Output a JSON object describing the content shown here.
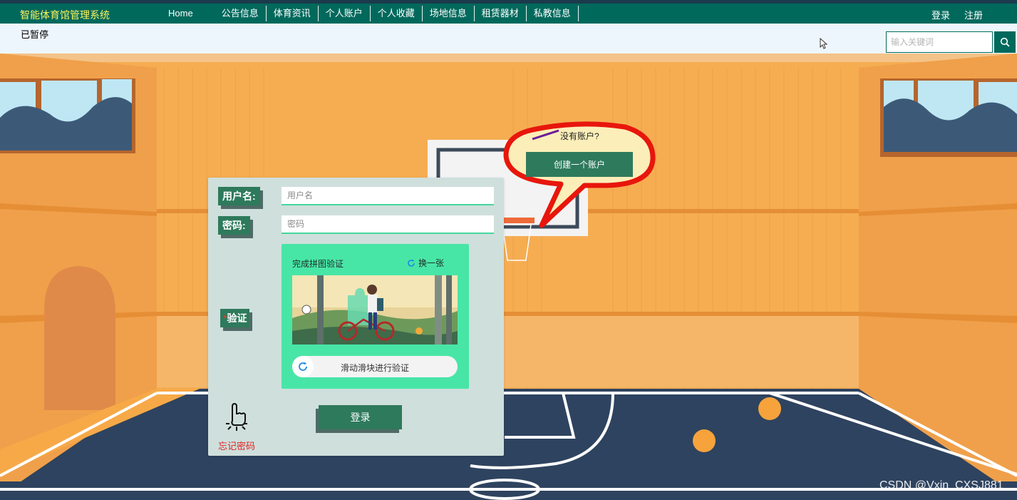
{
  "nav": {
    "brand": "智能体育馆管理系统",
    "items": [
      "Home",
      "公告信息",
      "体育资讯",
      "个人账户",
      "个人收藏",
      "场地信息",
      "租赁器材",
      "私教信息"
    ],
    "login": "登录",
    "register": "注册"
  },
  "status_text": "已暂停",
  "search": {
    "placeholder": "输入关键词",
    "icon": "search-icon"
  },
  "login_form": {
    "username_label": "用户名:",
    "username_placeholder": "用户名",
    "password_label": "密码:",
    "password_placeholder": "密码",
    "captcha_label": "验证",
    "captcha_required_mark": "*",
    "captcha_title": "完成拼图验证",
    "captcha_refresh": "换一张",
    "slider_hint": "滑动滑块进行验证",
    "submit": "登录",
    "forgot": "忘记密码"
  },
  "bubble": {
    "question": "没有账户?",
    "create": "创建一个账户"
  },
  "watermark": "CSDN @Vxin_CXSJ881",
  "colors": {
    "nav": "#00695c",
    "brand_text": "#fff35c",
    "accent_green": "#2e7a5c",
    "captcha_bg": "#48e6a6",
    "forgot_red": "#e0231f",
    "bubble_outline": "#e8160c"
  }
}
